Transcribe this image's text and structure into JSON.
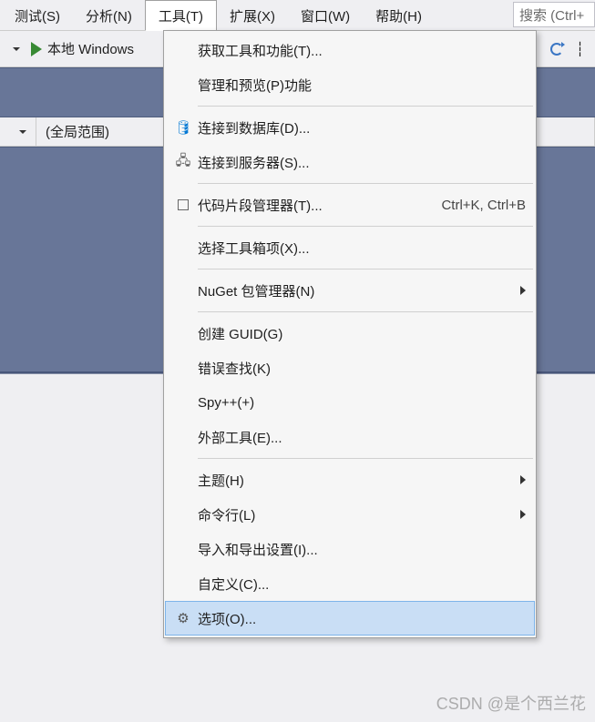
{
  "menubar": {
    "items": [
      {
        "label": "测试(S)"
      },
      {
        "label": "分析(N)"
      },
      {
        "label": "工具(T)",
        "active": true
      },
      {
        "label": "扩展(X)"
      },
      {
        "label": "窗口(W)"
      },
      {
        "label": "帮助(H)"
      }
    ],
    "search_placeholder": "搜索 (Ctrl+"
  },
  "toolbar": {
    "run_label": "本地 Windows"
  },
  "scopebar": {
    "scope_label": "(全局范围)"
  },
  "tools_menu": {
    "items": [
      {
        "label": "获取工具和功能(T)...",
        "icon": ""
      },
      {
        "label": "管理和预览(P)功能",
        "icon": ""
      },
      {
        "sep": true
      },
      {
        "label": "连接到数据库(D)...",
        "icon": "db"
      },
      {
        "label": "连接到服务器(S)...",
        "icon": "server"
      },
      {
        "sep": true
      },
      {
        "label": "代码片段管理器(T)...",
        "icon": "box",
        "shortcut": "Ctrl+K, Ctrl+B"
      },
      {
        "sep": true
      },
      {
        "label": "选择工具箱项(X)...",
        "icon": ""
      },
      {
        "sep": true
      },
      {
        "label": "NuGet 包管理器(N)",
        "icon": "",
        "submenu": true
      },
      {
        "sep": true
      },
      {
        "label": "创建 GUID(G)",
        "icon": ""
      },
      {
        "label": "错误查找(K)",
        "icon": ""
      },
      {
        "label": "Spy++(+)",
        "icon": ""
      },
      {
        "label": "外部工具(E)...",
        "icon": ""
      },
      {
        "sep": true
      },
      {
        "label": "主题(H)",
        "icon": "",
        "submenu": true
      },
      {
        "label": "命令行(L)",
        "icon": "",
        "submenu": true
      },
      {
        "label": "导入和导出设置(I)...",
        "icon": ""
      },
      {
        "label": "自定义(C)...",
        "icon": ""
      },
      {
        "label": "选项(O)...",
        "icon": "gear",
        "highlighted": true
      }
    ]
  },
  "watermark": "CSDN @是个西兰花"
}
